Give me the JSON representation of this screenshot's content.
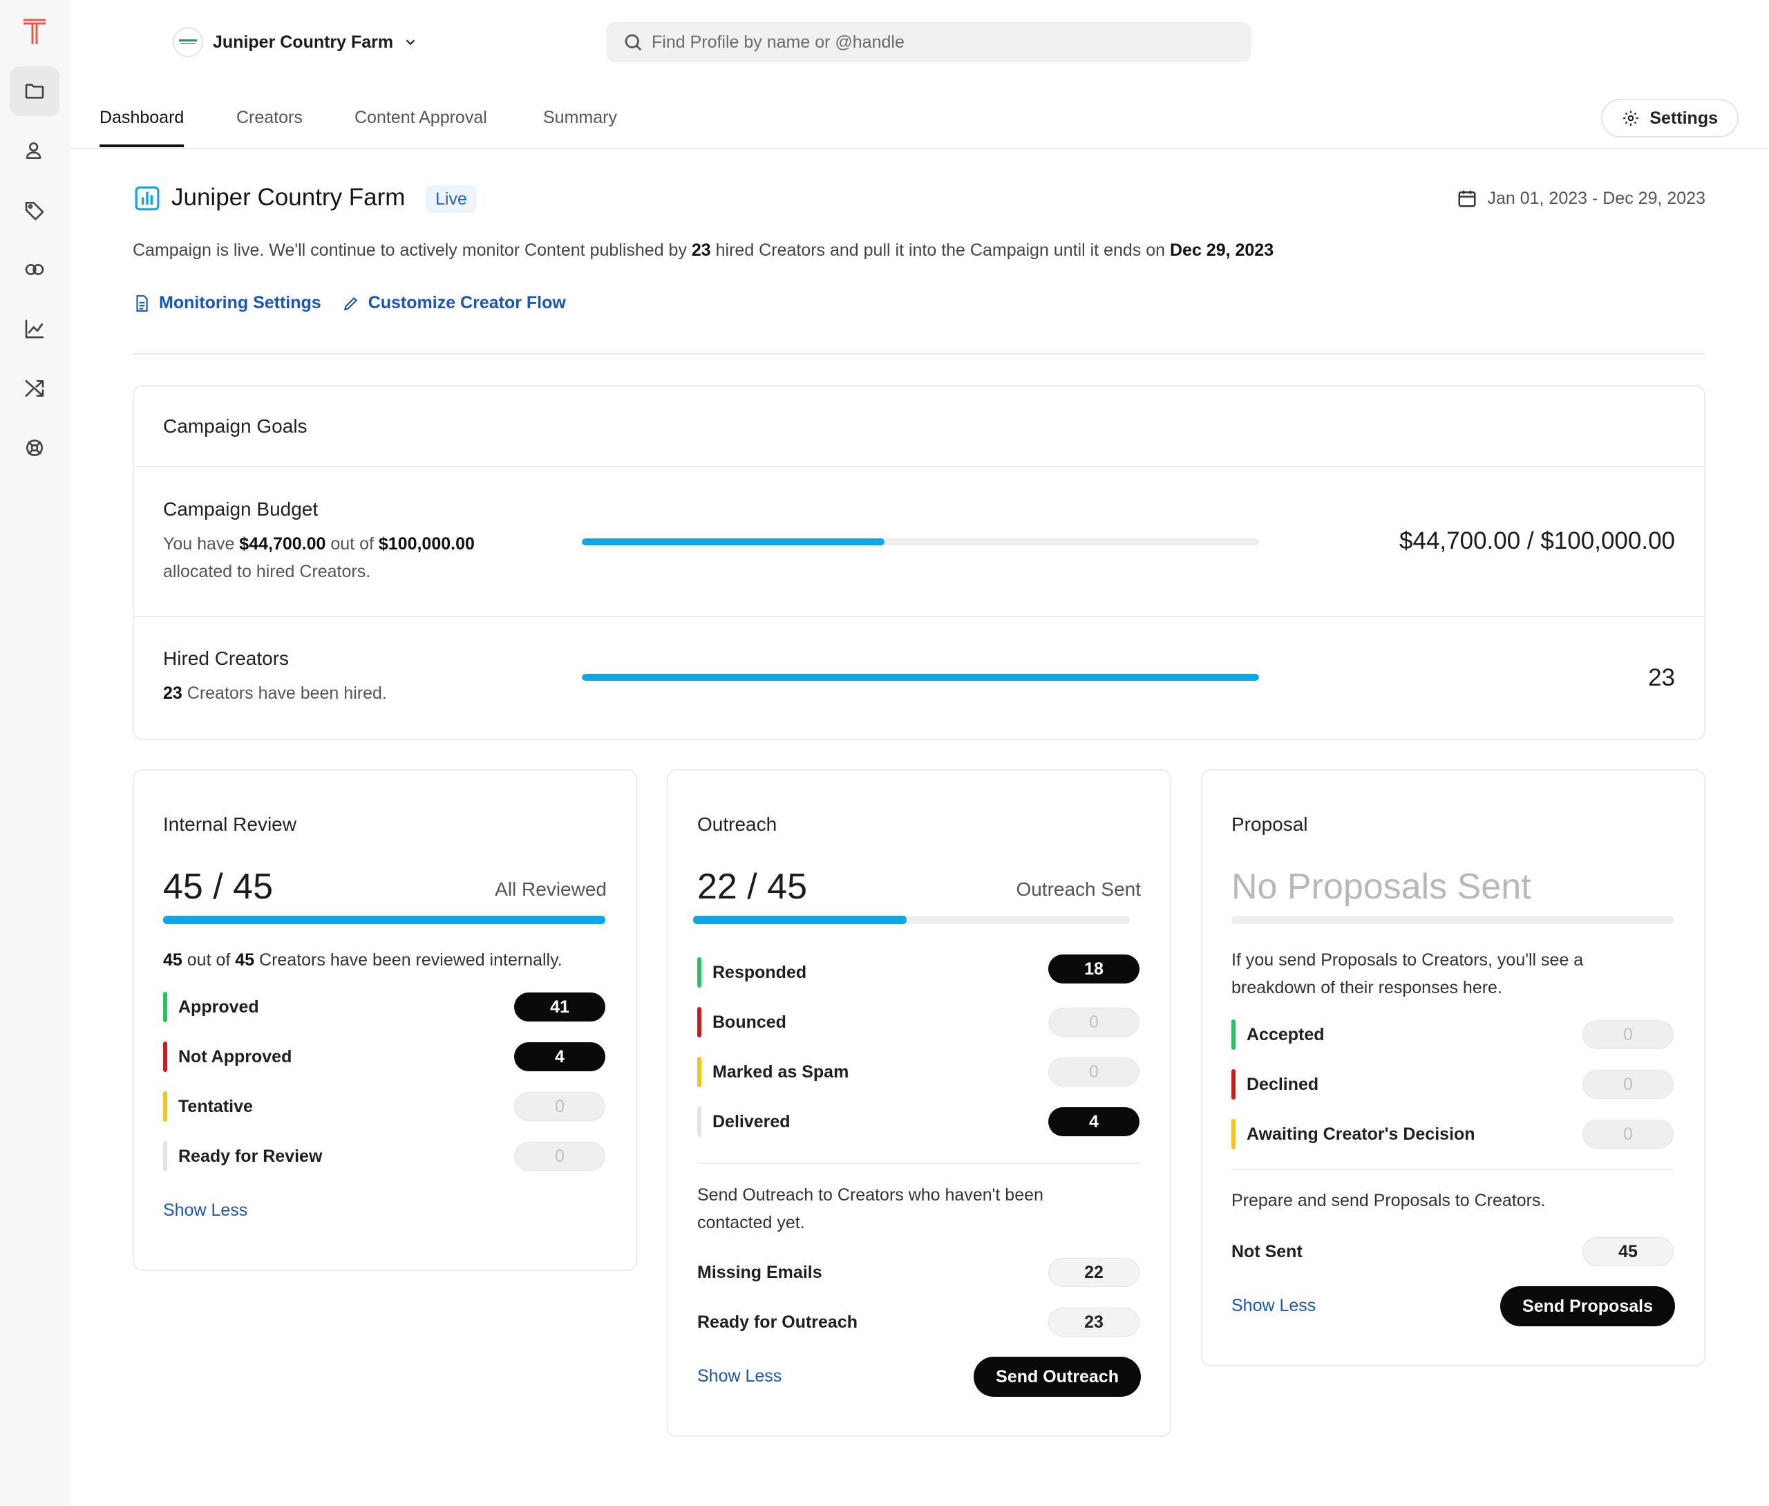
{
  "account": {
    "name": "Juniper Country Farm"
  },
  "search": {
    "placeholder": "Find Profile by name or @handle"
  },
  "tabs": [
    {
      "label": "Dashboard",
      "active": true
    },
    {
      "label": "Creators"
    },
    {
      "label": "Content Approval"
    },
    {
      "label": "Summary"
    }
  ],
  "settings": {
    "label": "Settings"
  },
  "sidebar": {
    "icons": [
      "folder-icon",
      "user-icon",
      "tag-icon",
      "link-icon",
      "chart-icon",
      "shuffle-icon",
      "support-icon"
    ],
    "active": "folder-icon"
  },
  "campaign": {
    "title": "Juniper Country Farm",
    "status": "Live",
    "date_range": "Jan 01, 2023 - Dec 29, 2023",
    "desc_pre": "Campaign is live. We'll continue to actively monitor Content published by ",
    "desc_count": "23",
    "desc_mid": " hired Creators and pull it into the Campaign until it ends on ",
    "desc_end": "Dec 29, 2023",
    "monitoring_link": "Monitoring Settings",
    "customize_link": "Customize Creator Flow"
  },
  "goals": {
    "heading": "Campaign Goals",
    "budget": {
      "title": "Campaign Budget",
      "sub_pre": "You have ",
      "allocated": "$44,700.00",
      "sub_mid": " out of ",
      "total": "$100,000.00",
      "sub_end": "allocated to hired Creators.",
      "value": "$44,700.00 / $100,000.00",
      "progress": 0.447
    },
    "hired": {
      "title": "Hired Creators",
      "count": "23",
      "sub_end": " Creators have been hired.",
      "value": "23",
      "progress": 1.0
    }
  },
  "internal_review": {
    "title": "Internal Review",
    "big": "45 / 45",
    "caption": "All Reviewed",
    "progress": 1.0,
    "summary_a": "45",
    "summary_mid": " out of ",
    "summary_b": "45",
    "summary_end": " Creators have been reviewed internally.",
    "rows": [
      {
        "label": "Approved",
        "value": "41",
        "color": "#22c55e",
        "style": "dark"
      },
      {
        "label": "Not Approved",
        "value": "4",
        "color": "#c81e1e",
        "style": "dark"
      },
      {
        "label": "Tentative",
        "value": "0",
        "color": "#f5c518",
        "style": "empty"
      },
      {
        "label": "Ready for Review",
        "value": "0",
        "color": "#e3e3e3",
        "style": "empty"
      }
    ],
    "show_less": "Show Less"
  },
  "outreach": {
    "title": "Outreach",
    "big": "22 / 45",
    "caption": "Outreach Sent",
    "progress": 0.489,
    "rows": [
      {
        "label": "Responded",
        "value": "18",
        "color": "#22c55e",
        "style": "dark"
      },
      {
        "label": "Bounced",
        "value": "0",
        "color": "#c81e1e",
        "style": "empty"
      },
      {
        "label": "Marked as Spam",
        "value": "0",
        "color": "#f5c518",
        "style": "empty"
      },
      {
        "label": "Delivered",
        "value": "4",
        "color": "#e3e3e3",
        "style": "dark"
      }
    ],
    "send_text": "Send Outreach to Creators who haven't been contacted yet.",
    "missing_label": "Missing Emails",
    "missing_value": "22",
    "ready_label": "Ready for Outreach",
    "ready_value": "23",
    "show_less": "Show Less",
    "button": "Send Outreach"
  },
  "proposal": {
    "title": "Proposal",
    "big": "No Proposals Sent",
    "progress": 0,
    "info": "If you send Proposals to Creators, you'll see a breakdown of their responses here.",
    "rows": [
      {
        "label": "Accepted",
        "value": "0",
        "color": "#22c55e",
        "style": "empty"
      },
      {
        "label": "Declined",
        "value": "0",
        "color": "#c81e1e",
        "style": "empty"
      },
      {
        "label": "Awaiting Creator's Decision",
        "value": "0",
        "color": "#f5c518",
        "style": "empty"
      }
    ],
    "prepare_text": "Prepare and send Proposals to Creators.",
    "not_sent_label": "Not Sent",
    "not_sent_value": "45",
    "show_less": "Show Less",
    "button": "Send Proposals"
  }
}
